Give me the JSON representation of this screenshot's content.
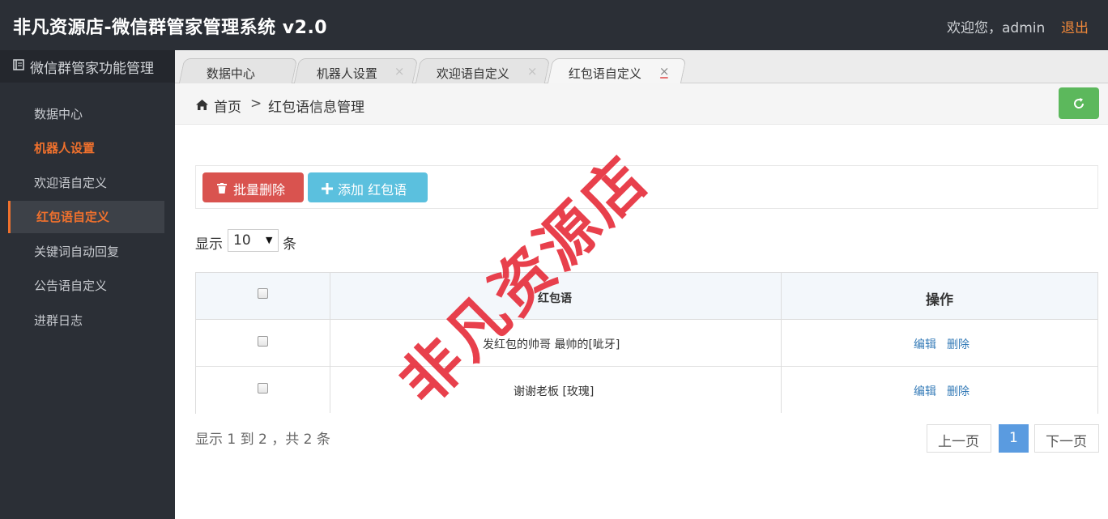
{
  "header": {
    "title": "非凡资源店-微信群管家管理系统  v2.0",
    "welcome": "欢迎您，admin",
    "logout": "退出"
  },
  "sidebar": {
    "title": "微信群管家功能管理",
    "items": [
      {
        "label": "数据中心"
      },
      {
        "label": "机器人设置"
      },
      {
        "label": "欢迎语自定义"
      },
      {
        "label": "红包语自定义"
      },
      {
        "label": "关键词自动回复"
      },
      {
        "label": "公告语自定义"
      },
      {
        "label": "进群日志"
      }
    ]
  },
  "tabs": [
    {
      "label": "数据中心"
    },
    {
      "label": "机器人设置"
    },
    {
      "label": "欢迎语自定义"
    },
    {
      "label": "红包语自定义"
    }
  ],
  "breadcrumb": {
    "home": "首页",
    "separator": ">",
    "current": "红包语信息管理"
  },
  "toolbar": {
    "batch_delete": "批量删除",
    "add": "添加 红包语"
  },
  "length": {
    "prefix": "显示",
    "value": "10",
    "suffix": "条"
  },
  "table": {
    "headers": {
      "text": "红包语",
      "ops": "操作"
    },
    "rows": [
      {
        "text": "发红包的帅哥 最帅的[呲牙]",
        "edit": "编辑",
        "delete": "删除"
      },
      {
        "text": "谢谢老板 [玫瑰]",
        "edit": "编辑",
        "delete": "删除"
      }
    ]
  },
  "footer": {
    "info": "显示 1 到 2 ，共 2 条"
  },
  "pagination": {
    "prev": "上一页",
    "current": "1",
    "next": "下一页"
  },
  "watermark": "非凡资源店",
  "colors": {
    "accent": "#f0712d",
    "danger": "#d9534f",
    "info": "#5bc0de",
    "success": "#5cb85c",
    "link": "#337ab7",
    "dark_bg": "#2b2f36"
  }
}
